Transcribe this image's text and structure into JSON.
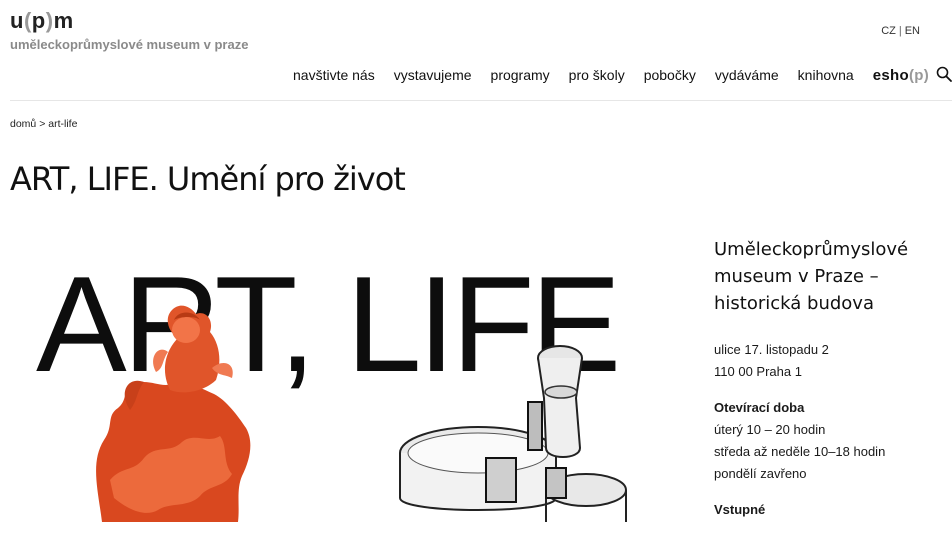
{
  "header": {
    "logo_u": "u",
    "logo_paren_open": "(",
    "logo_p": "p",
    "logo_paren_close": ")",
    "logo_m": "m",
    "logo_subtitle": "uměleckoprůmyslové museum v praze",
    "lang": {
      "cz": "CZ",
      "separator": "|",
      "en": "EN"
    }
  },
  "nav": {
    "items": [
      {
        "label": "navštivte nás"
      },
      {
        "label": "vystavujeme"
      },
      {
        "label": "programy"
      },
      {
        "label": "pro školy"
      },
      {
        "label": "pobočky"
      },
      {
        "label": "vydáváme"
      },
      {
        "label": "knihovna"
      }
    ],
    "esho": {
      "text": "esho",
      "paren_open": "(",
      "p": "p",
      "paren_close": ")"
    },
    "search_icon": "search-icon"
  },
  "breadcrumb": {
    "home": "domů",
    "separator": ">",
    "current": "art-life"
  },
  "page": {
    "title": "ART, LIFE. Umění pro život"
  },
  "hero": {
    "text": "ART, LIFE"
  },
  "sidebar": {
    "title": "Uměleckoprůmyslové museum v Praze – historická budova",
    "address_line1": "ulice 17. listopadu 2",
    "address_line2": "110 00 Praha 1",
    "hours_label": "Otevírací doba",
    "hours_line1": "úterý 10 – 20 hodin",
    "hours_line2": "středa až neděle 10–18 hodin",
    "hours_line3": "pondělí zavřeno",
    "admission_label": "Vstupné"
  },
  "colors": {
    "accent_grey": "#999999",
    "coral_sculpture": "#e0502a",
    "text": "#111111"
  }
}
